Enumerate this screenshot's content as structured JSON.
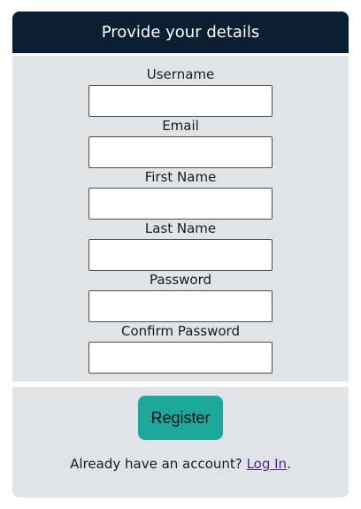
{
  "header": {
    "title": "Provide your details"
  },
  "form": {
    "fields": [
      {
        "label": "Username",
        "value": ""
      },
      {
        "label": "Email",
        "value": ""
      },
      {
        "label": "First Name",
        "value": ""
      },
      {
        "label": "Last Name",
        "value": ""
      },
      {
        "label": "Password",
        "value": ""
      },
      {
        "label": "Confirm Password",
        "value": ""
      }
    ]
  },
  "footer": {
    "register_label": "Register",
    "login_prompt": "Already have an account?",
    "login_link": "Log In",
    "login_suffix": "."
  },
  "colors": {
    "header_bg": "#0b1f33",
    "panel_bg": "#e1e4e7",
    "button_bg": "#1ba89b",
    "link": "#4b2a8c"
  }
}
